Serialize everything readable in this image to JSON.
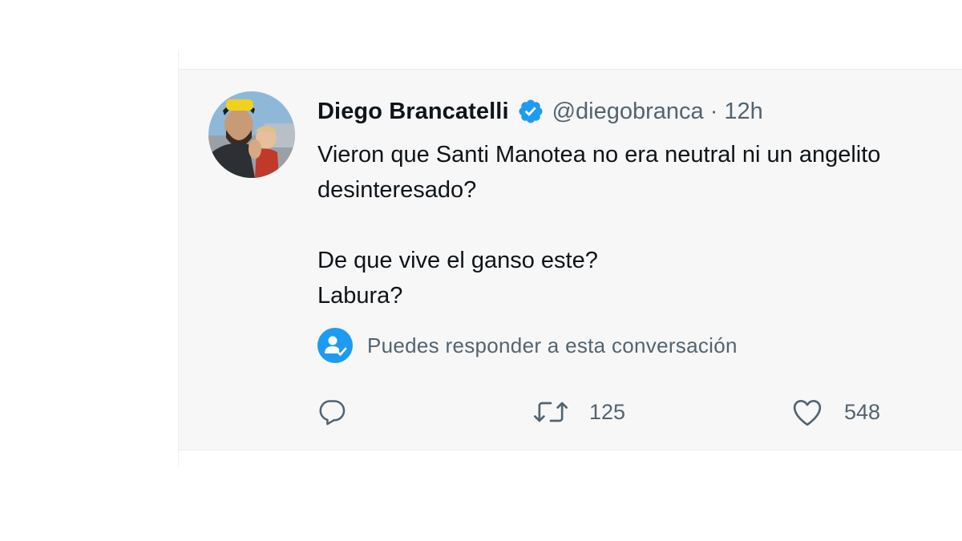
{
  "tweet": {
    "author_name": "Diego Brancatelli",
    "author_handle": "@diegobranca",
    "separator": "·",
    "timestamp": "12h",
    "text": "Vieron que Santi Manotea no era neutral ni un angelito\ndesinteresado?\n\nDe que vive el ganso este?\nLabura?",
    "reply_notice": "Puedes responder a esta conversación",
    "actions": {
      "reply": {
        "icon": "reply-icon",
        "count": ""
      },
      "retweet": {
        "icon": "retweet-icon",
        "count": "125"
      },
      "like": {
        "icon": "heart-icon",
        "count": "548"
      }
    }
  },
  "colors": {
    "verified_blue": "#1d9bf0",
    "text_primary": "#0f1419",
    "text_secondary": "#536471",
    "card_background": "#f7f7f7"
  }
}
